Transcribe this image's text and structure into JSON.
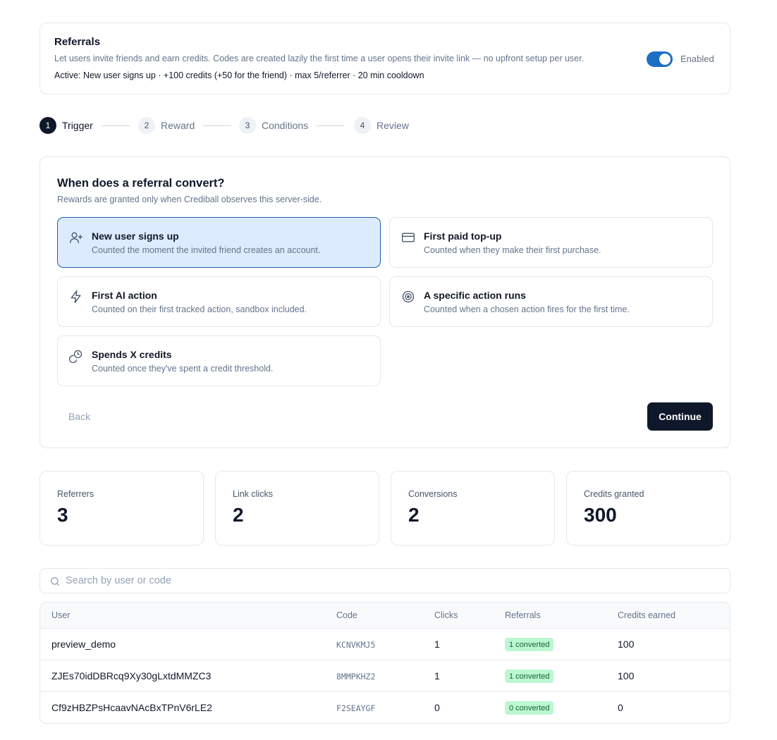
{
  "referrals": {
    "title": "Referrals",
    "description": "Let users invite friends and earn credits. Codes are created lazily the first time a user opens their invite link — no upfront setup per user.",
    "active_summary": "Active: New user signs up · +100 credits (+50 for the friend) · max 5/referrer · 20 min cooldown",
    "toggle_label": "Enabled",
    "toggle_on": true,
    "accent_color": "#1d6fc4"
  },
  "stepper": {
    "steps": [
      {
        "num": "1",
        "label": "Trigger",
        "active": true
      },
      {
        "num": "2",
        "label": "Reward",
        "active": false
      },
      {
        "num": "3",
        "label": "Conditions",
        "active": false
      },
      {
        "num": "4",
        "label": "Review",
        "active": false
      }
    ]
  },
  "trigger": {
    "title": "When does a referral convert?",
    "subtitle": "Rewards are granted only when Crediball observes this server-side.",
    "options": [
      {
        "icon": "user-plus-icon",
        "title": "New user signs up",
        "desc": "Counted the moment the invited friend creates an account.",
        "selected": true
      },
      {
        "icon": "credit-card-icon",
        "title": "First paid top-up",
        "desc": "Counted when they make their first purchase.",
        "selected": false
      },
      {
        "icon": "lightning-icon",
        "title": "First AI action",
        "desc": "Counted on their first tracked action, sandbox included.",
        "selected": false
      },
      {
        "icon": "target-icon",
        "title": "A specific action runs",
        "desc": "Counted when a chosen action fires for the first time.",
        "selected": false
      },
      {
        "icon": "coins-icon",
        "title": "Spends X credits",
        "desc": "Counted once they've spent a credit threshold.",
        "selected": false
      }
    ],
    "back_label": "Back",
    "continue_label": "Continue"
  },
  "stats": [
    {
      "label": "Referrers",
      "value": "3"
    },
    {
      "label": "Link clicks",
      "value": "2"
    },
    {
      "label": "Conversions",
      "value": "2"
    },
    {
      "label": "Credits granted",
      "value": "300"
    }
  ],
  "search": {
    "placeholder": "Search by user or code",
    "value": ""
  },
  "table": {
    "headers": {
      "user": "User",
      "code": "Code",
      "clicks": "Clicks",
      "referrals": "Referrals",
      "credits": "Credits earned"
    },
    "rows": [
      {
        "user": "preview_demo",
        "code": "KCNVKMJ5",
        "clicks": "1",
        "referrals": "1 converted",
        "credits": "100"
      },
      {
        "user": "ZJEs70idDBRcq9Xy30gLxtdMMZC3",
        "code": "8MMPKHZ2",
        "clicks": "1",
        "referrals": "1 converted",
        "credits": "100"
      },
      {
        "user": "Cf9zHBZPsHcaavNAcBxTPnV6rLE2",
        "code": "F2SEAYGF",
        "clicks": "0",
        "referrals": "0 converted",
        "credits": "0"
      }
    ]
  }
}
